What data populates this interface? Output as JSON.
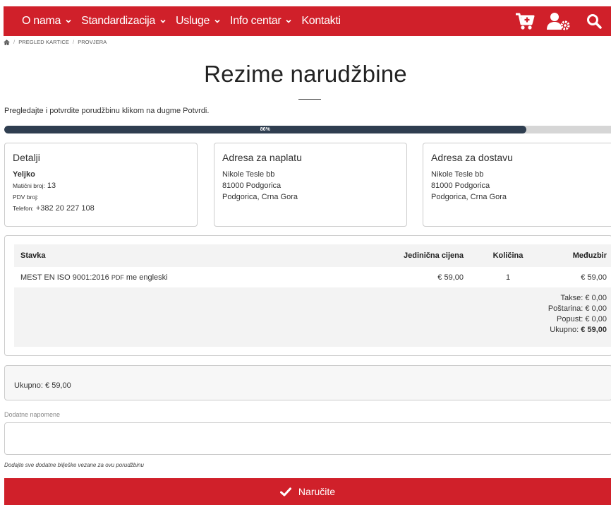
{
  "nav": {
    "items": [
      {
        "label": "O nama",
        "has_dropdown": true
      },
      {
        "label": "Standardizacija",
        "has_dropdown": true
      },
      {
        "label": "Usluge",
        "has_dropdown": true
      },
      {
        "label": "Info centar",
        "has_dropdown": true
      },
      {
        "label": "Kontakti",
        "has_dropdown": false
      }
    ],
    "icons": [
      "cart-add-icon",
      "user-settings-icon",
      "search-icon"
    ],
    "color": "#d0202a"
  },
  "breadcrumb": {
    "home_icon": "home-icon",
    "items": [
      "PREGLED KARTICE",
      "PROVJERA"
    ]
  },
  "page": {
    "title": "Rezime narudžbine",
    "intro": "Pregledajte i potvrdite porudžbinu klikom na dugme Potvrdi."
  },
  "progress": {
    "value": 0.86,
    "label": "86%",
    "fill_color": "#2f3e50"
  },
  "details": {
    "title": "Detalji",
    "name": "Yeljko",
    "mb_label": "Matični broj:",
    "mb_value": "13",
    "pdv_label": "PDV broj:",
    "pdv_value": "",
    "phone_label": "Telefon:",
    "phone_value": "+382 20 227 108"
  },
  "billing": {
    "title": "Adresa za naplatu",
    "lines": [
      "Nikole Tesle bb",
      "81000 Podgorica",
      "Podgorica, Crna Gora"
    ]
  },
  "shipping": {
    "title": "Adresa za dostavu",
    "lines": [
      "Nikole Tesle bb",
      "81000 Podgorica",
      "Podgorica, Crna Gora"
    ]
  },
  "items": {
    "headers": {
      "item": "Stavka",
      "unit_price": "Jedinična cijena",
      "qty": "Količina",
      "subtotal": "Međuzbir"
    },
    "rows": [
      {
        "name": "MEST EN ISO 9001:2016",
        "format": "PDF",
        "lang": "me engleski",
        "unit_price": "€ 59,00",
        "qty": "1",
        "subtotal": "€ 59,00"
      }
    ],
    "totals": {
      "tax_label": "Takse:",
      "tax": "€ 0,00",
      "shipping_label": "Poštarina:",
      "shipping": "€ 0,00",
      "discount_label": "Popust:",
      "discount": "€ 0,00",
      "total_label": "Ukupno:",
      "total": "€ 59,00"
    }
  },
  "summary": {
    "text": "Ukupno: € 59,00"
  },
  "notes": {
    "label": "Dodatne napomene",
    "value": "",
    "help": "Dodajte sve dodatne bilješke vezane za ovu porudžbinu"
  },
  "submit": {
    "label": "Naručite",
    "icon": "check-icon"
  }
}
